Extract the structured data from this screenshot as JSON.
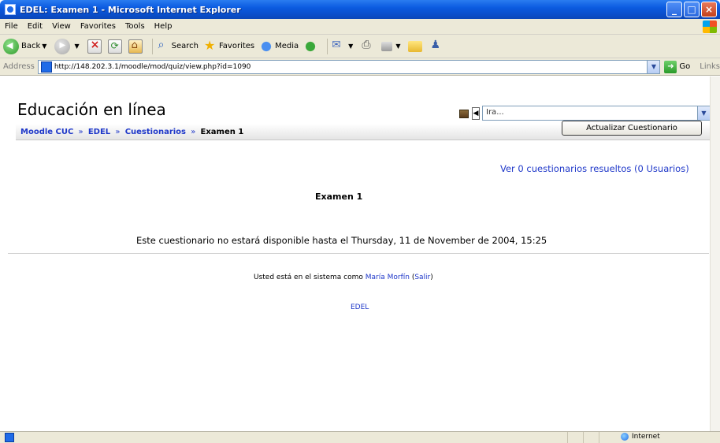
{
  "window": {
    "title": "EDEL: Examen 1 - Microsoft Internet Explorer"
  },
  "menu": [
    "File",
    "Edit",
    "View",
    "Favorites",
    "Tools",
    "Help"
  ],
  "toolbar": {
    "back_label": "Back",
    "search_label": "Search",
    "favorites_label": "Favorites",
    "media_label": "Media"
  },
  "addressbar": {
    "label": "Address",
    "url": "http://148.202.3.1/moodle/mod/quiz/view.php?id=1090",
    "go_label": "Go",
    "links_label": "Links"
  },
  "page": {
    "site_title": "Educación en línea",
    "jump_value": "Ira...",
    "breadcrumb": {
      "home": "Moodle CUC",
      "course": "EDEL",
      "section": "Cuestionarios",
      "current": "Examen 1",
      "separator": "»"
    },
    "update_button": "Actualizar Cuestionario",
    "results_link": "Ver 0 cuestionarios resueltos (0 Usuarios)",
    "quiz_title": "Examen 1",
    "availability_msg": "Este cuestionario no estará disponible hasta el Thursday, 11 de November de 2004, 15:25",
    "login": {
      "prefix": "Usted está en el sistema como",
      "user": "María Morfín",
      "logout": "Salir"
    },
    "footer_link": "EDEL"
  },
  "status": {
    "zone": "Internet"
  },
  "colors": {
    "link": "#1f38c9",
    "titlebar": "#0b5be0",
    "chrome": "#ece9d8"
  }
}
